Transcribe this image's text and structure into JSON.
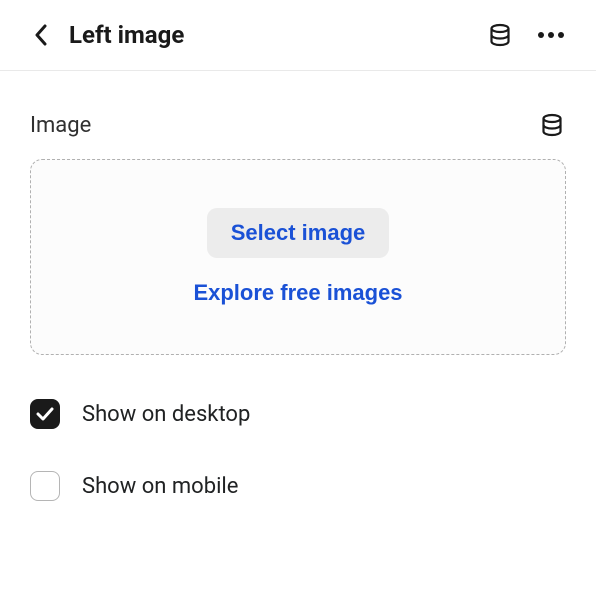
{
  "header": {
    "title": "Left image"
  },
  "section": {
    "label": "Image"
  },
  "dropzone": {
    "select_label": "Select image",
    "explore_label": "Explore free images"
  },
  "checkboxes": {
    "desktop": {
      "label": "Show on desktop",
      "checked": true
    },
    "mobile": {
      "label": "Show on mobile",
      "checked": false
    }
  }
}
